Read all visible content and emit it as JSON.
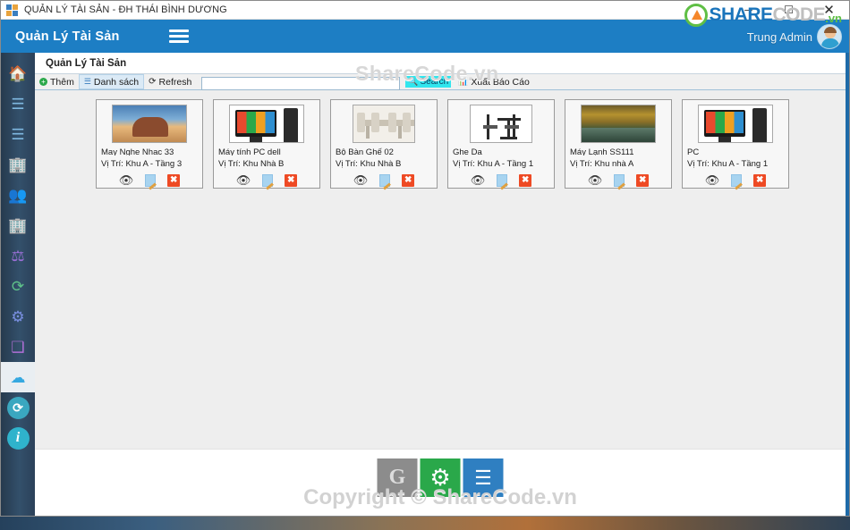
{
  "window": {
    "title": "QUẢN LÝ TÀI SẢN - ĐH THÁI BÌNH DƯƠNG",
    "minimize_label": "─",
    "maximize_label": "☐",
    "close_label": "✕"
  },
  "header": {
    "app_title": "Quản Lý Tài Sản",
    "brand": {
      "share": "SHARE",
      "code": "CODE",
      "tld": ".vn"
    },
    "username": "Trung Admin"
  },
  "sidebar": {
    "items": [
      {
        "name": "sidebar-item-home",
        "icon": "home-icon",
        "glyph": "🏠",
        "cls": "ico-home"
      },
      {
        "name": "sidebar-item-list-1",
        "icon": "list-icon",
        "glyph": "☰",
        "cls": "ico-list"
      },
      {
        "name": "sidebar-item-list-2",
        "icon": "list-icon",
        "glyph": "☰",
        "cls": "ico-list"
      },
      {
        "name": "sidebar-item-department",
        "icon": "building-person-icon",
        "glyph": "🏢",
        "cls": "ico-bld"
      },
      {
        "name": "sidebar-item-users",
        "icon": "users-icon",
        "glyph": "👥",
        "cls": "ico-ppl"
      },
      {
        "name": "sidebar-item-building",
        "icon": "building-icon",
        "glyph": "🏢",
        "cls": "ico-bld"
      },
      {
        "name": "sidebar-item-rules",
        "icon": "scales-icon",
        "glyph": "⚖",
        "cls": "ico-scale"
      },
      {
        "name": "sidebar-item-finance",
        "icon": "money-refresh-icon",
        "glyph": "⟳",
        "cls": "ico-money"
      },
      {
        "name": "sidebar-item-settings",
        "icon": "gears-icon",
        "glyph": "⚙",
        "cls": "ico-gear"
      },
      {
        "name": "sidebar-item-qa",
        "icon": "qa-cube-icon",
        "glyph": "❑",
        "cls": "ico-qa"
      },
      {
        "name": "sidebar-item-assets",
        "icon": "cloud-upload-icon",
        "glyph": "☁",
        "cls": "ico-cloud",
        "selected": true
      },
      {
        "name": "sidebar-item-sync",
        "icon": "sync-icon",
        "glyph": "⟳",
        "circle": true
      },
      {
        "name": "sidebar-item-info",
        "icon": "info-icon",
        "glyph": "i",
        "circle": true,
        "info": true
      }
    ]
  },
  "panel": {
    "title": "Quản Lý Tài Sản",
    "watermark": "ShareCode.vn"
  },
  "toolbar": {
    "add_label": "Thêm",
    "add_icon": "plus-circle-icon",
    "list_label": "Danh sách",
    "list_icon": "list-icon",
    "refresh_label": "Refresh",
    "refresh_icon": "refresh-icon",
    "search_value": "",
    "search_placeholder": "",
    "search_button_label": "Search",
    "search_button_icon": "magnifier-icon",
    "export_label": "Xuất Báo Cáo",
    "export_icon": "chart-bars-icon"
  },
  "cards": [
    {
      "name": "May Nghe Nhac 33",
      "location": "Vị Trí: Khu A - Tầng 3",
      "art": "rock"
    },
    {
      "name": "Máy tính PC dell",
      "location": "Vị Trí: Khu Nhà B",
      "art": "pc"
    },
    {
      "name": "Bộ Bàn Ghế 02",
      "location": "Vị Trí: Khu Nhà B",
      "art": "table"
    },
    {
      "name": "Ghe Da",
      "location": "Vị Trí: Khu A - Tầng 1",
      "art": "chair"
    },
    {
      "name": "Máy Lạnh SS111",
      "location": "Vị Trí: Khu nhà A",
      "art": "forest"
    },
    {
      "name": "PC",
      "location": "Vị Trí: Khu A - Tầng 1",
      "art": "pc"
    }
  ],
  "card_actions": {
    "view_icon": "eye-icon",
    "edit_icon": "edit-document-icon",
    "delete_icon": "delete-icon",
    "delete_label": "✖"
  },
  "footer": {
    "buttons": [
      {
        "name": "footer-button-g",
        "icon": "g-logo-icon",
        "glyph": "G",
        "cls": "gray"
      },
      {
        "name": "footer-button-settings",
        "icon": "gear-icon",
        "glyph": "⚙",
        "cls": "green"
      },
      {
        "name": "footer-button-list",
        "icon": "list-icon",
        "glyph": "☰",
        "cls": "blue"
      }
    ],
    "watermark": "Copyright © ShareCode.vn"
  },
  "colors": {
    "header_blue": "#1d7ec4",
    "sidebar_navy": "#2f455c",
    "content_gray": "#eeeeee",
    "accent_green": "#5fbf45",
    "search_cyan": "#31e6ee",
    "delete_red": "#ee4a24"
  }
}
